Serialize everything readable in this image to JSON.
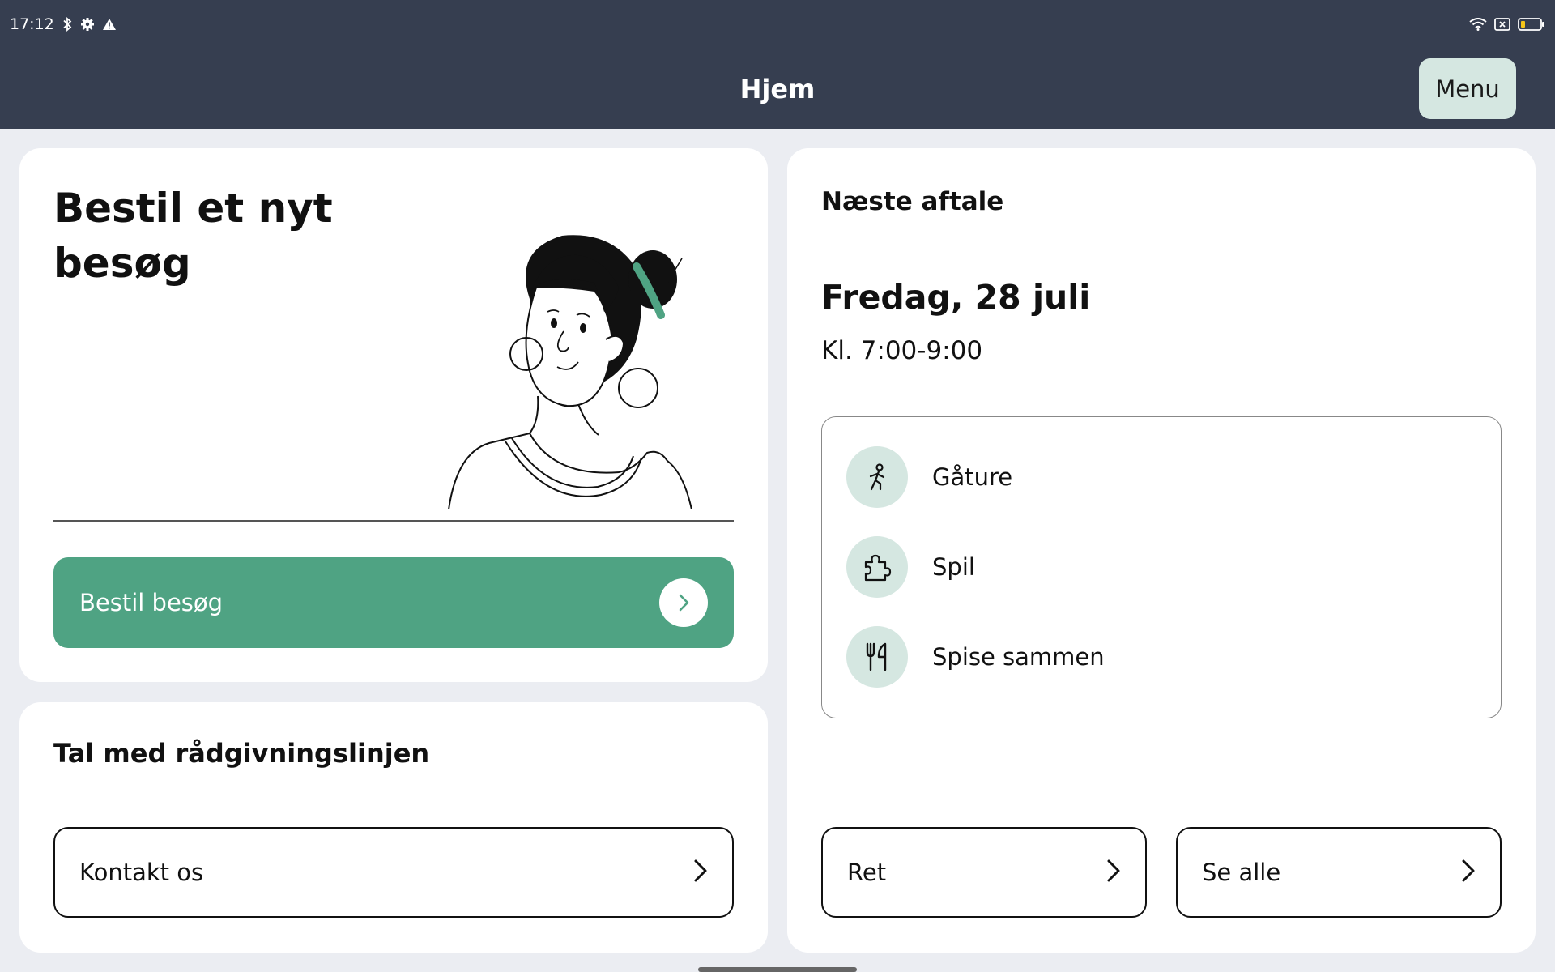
{
  "status_bar": {
    "time": "17:12",
    "icons_left": [
      "bluetooth-icon",
      "gear-icon",
      "warning-icon"
    ],
    "icons_right": [
      "wifi-icon",
      "sim-icon",
      "battery-icon"
    ]
  },
  "header": {
    "title": "Hjem",
    "menu_label": "Menu"
  },
  "order_card": {
    "title": "Bestil et nyt besøg",
    "illustration": "woman-illustration",
    "button_label": "Bestil besøg"
  },
  "advice_card": {
    "title": "Tal med rådgivningslinjen",
    "contact_label": "Kontakt os"
  },
  "next_card": {
    "label": "Næste aftale",
    "date": "Fredag, 28 juli",
    "time": "Kl. 7:00-9:00",
    "activities": [
      {
        "label": "Gåture",
        "icon": "walking-icon"
      },
      {
        "label": "Spil",
        "icon": "puzzle-icon"
      },
      {
        "label": "Spise sammen",
        "icon": "cutlery-icon"
      }
    ],
    "edit_label": "Ret",
    "see_all_label": "Se alle"
  },
  "colors": {
    "header_bg": "#363e50",
    "accent_green": "#4fa383",
    "mint": "#d5e7e1",
    "page_bg": "#ebedf2"
  }
}
